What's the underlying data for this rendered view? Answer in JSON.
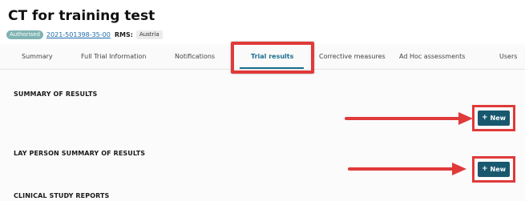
{
  "header": {
    "title": "CT for training test",
    "status_badge": "Authorised",
    "trial_id": "2021-501398-35-00",
    "rms_label": "RMS:",
    "rms_country": "Austria"
  },
  "tabs": [
    {
      "label": "Summary"
    },
    {
      "label": "Full Trial Information"
    },
    {
      "label": "Notifications"
    },
    {
      "label": "Trial results"
    },
    {
      "label": "Corrective measures"
    },
    {
      "label": "Ad Hoc assessments"
    },
    {
      "label": "Users"
    }
  ],
  "active_tab": "Trial results",
  "sections": {
    "summary_of_results": {
      "title": "SUMMARY OF RESULTS",
      "button": "New"
    },
    "lay_person_summary": {
      "title": "LAY PERSON SUMMARY OF RESULTS",
      "button": "New"
    },
    "clinical_study_reports": {
      "title": "CLINICAL STUDY REPORTS"
    }
  },
  "colors": {
    "highlight": "#e03a3a",
    "primary_button": "#18586f",
    "active_tab": "#1c6e8e",
    "badge": "#7fb3b2"
  },
  "icons": {
    "plus": "plus-icon",
    "arrow": "arrow-right-icon"
  }
}
